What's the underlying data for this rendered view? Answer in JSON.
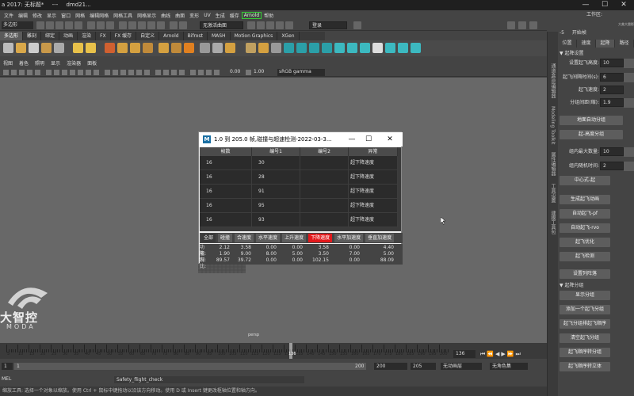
{
  "window": {
    "title": "a 2017: 无标题*",
    "extra1": "---",
    "extra2": "dmd21...",
    "min": "—",
    "max": "☐",
    "close": "✕"
  },
  "menu": {
    "items": [
      "文件",
      "编辑",
      "修改",
      "显示",
      "窗口",
      "网格",
      "编辑网格",
      "网格工具",
      "网格显示",
      "曲线",
      "曲面",
      "变形",
      "UV",
      "生成",
      "缓存"
    ],
    "arnold": "Arnold",
    "help": "帮助",
    "workspace_label": "工作区:"
  },
  "statusline": {
    "mode": "多边形",
    "object_label": "无激活曲面",
    "login": "登录"
  },
  "shelf": {
    "tabs": [
      "多边形",
      "雕刻",
      "绑定",
      "动画",
      "渲染",
      "FX",
      "FX 缓存",
      "自定义",
      "Arnold",
      "Bifrost",
      "MASH",
      "Motion Graphics",
      "XGen"
    ],
    "active": 0
  },
  "panel": {
    "menu": [
      "视图",
      "着色",
      "照明",
      "显示",
      "渲染器",
      "面板"
    ],
    "val1": "0.00",
    "val2": "1.00",
    "gamma": "sRGB gamma"
  },
  "viewport": {
    "camera": "persp"
  },
  "logo": {
    "text1": "大智控",
    "text2": "MODA"
  },
  "vertical_tabs": [
    "通道盒/层编辑器",
    "建模工具包",
    "属性编辑器",
    "工具设置",
    "Modeling Toolkit"
  ],
  "right_panel": {
    "top_label": "开始帧",
    "top_value": "-5",
    "brand": "大美大雷影音工作坊",
    "tabs": [
      "位置",
      "速度",
      "起降",
      "路径"
    ],
    "section1": "▼ 起降设置",
    "set_height_label": "设置起飞高度:",
    "set_height_value": "10",
    "interval_label": "起飞间隔时间(s):",
    "interval_value": "6",
    "speed_label": "起飞速度:",
    "speed_value": "2",
    "dist_label": "分组间距(缩):",
    "dist_value": "1.9",
    "btn_ground": "地面自动分组",
    "btn_height": "起-高度分组",
    "max_label": "组内最大数量:",
    "max_value": "10",
    "intra_label": "组内随机时间:",
    "intra_value": "2",
    "btn_center": "中心式-起",
    "btn_gen": "生成起飞动画",
    "btn_auto_pf": "自动起飞-pf",
    "btn_auto_rvo": "自动起飞-rvo",
    "btn_opt": "起飞优化",
    "btn_check": "起飞检测",
    "btn_formation": "设置列阵落",
    "section2": "▼ 起降分组",
    "btn_show": "显示分组",
    "btn_add": "添加一个起飞分组",
    "btn_sort": "起飞分组排起飞顺序",
    "btn_clear": "清空起飞分组",
    "btn_seq": "起飞顺序转分组",
    "btn_vol": "起飞顺序转立体"
  },
  "timeline": {
    "ticks": [
      "5",
      "10",
      "15",
      "20",
      "25",
      "30",
      "35",
      "40",
      "45",
      "50",
      "55",
      "60",
      "65",
      "70",
      "75",
      "80",
      "85",
      "90",
      "95",
      "100",
      "105",
      "110",
      "115",
      "120",
      "125",
      "130",
      "135",
      "140",
      "145",
      "150",
      "155",
      "160",
      "165",
      "170",
      "175",
      "180",
      "185",
      "190",
      "195",
      "200"
    ],
    "current": "136",
    "current_field": "136"
  },
  "range": {
    "start": "1",
    "start2": "1",
    "end": "200",
    "end2": "200",
    "max": "205",
    "char_label": "无动画层",
    "fps_label": "无角色集"
  },
  "cmdline": {
    "label": "MEL",
    "value": "Safety_flight_check"
  },
  "helpline": {
    "text": "缩放工具: 选择一个对象以缩放。使用 Ctrl + 鼠标中键拖动以沿该方向移动。使用 D 或 Insert 键更改枢轴位置和轴方向。"
  },
  "dialog": {
    "title": "1.0 到 205.0 帧,碰撞与超速检测-2022-03-3...",
    "logo": "M",
    "columns": [
      "帧数",
      "编号1",
      "编号2",
      "异常"
    ],
    "rows": [
      {
        "frame": "16",
        "id1": "30",
        "id2": "",
        "err": "超下降速度"
      },
      {
        "frame": "16",
        "id1": "28",
        "id2": "",
        "err": "超下降速度"
      },
      {
        "frame": "16",
        "id1": "91",
        "id2": "",
        "err": "超下降速度"
      },
      {
        "frame": "16",
        "id1": "95",
        "id2": "",
        "err": "超下降速度"
      },
      {
        "frame": "16",
        "id1": "93",
        "id2": "",
        "err": "超下降速度"
      }
    ],
    "buttons": [
      "全部",
      "碰撞",
      "合速度",
      "水平速度",
      "上升速度",
      "下降速度",
      "水平加速度",
      "垂直加速度"
    ],
    "stats": {
      "labels": [
        "功能:",
        "限制:",
        "占比:"
      ],
      "rows": [
        [
          "2.12",
          "3.58",
          "0.00",
          "0.00",
          "3.58",
          "0.00",
          "4.40"
        ],
        [
          "1.90",
          "9.00",
          "8.00",
          "5.00",
          "3.50",
          "7.00",
          "5.00"
        ],
        [
          "89.57",
          "39.72",
          "0.00",
          "0.00",
          "102.15",
          "0.00",
          "88.09"
        ]
      ]
    }
  },
  "colors": {
    "accent_red": "#e3191c",
    "arnold_green": "#33cc33"
  }
}
